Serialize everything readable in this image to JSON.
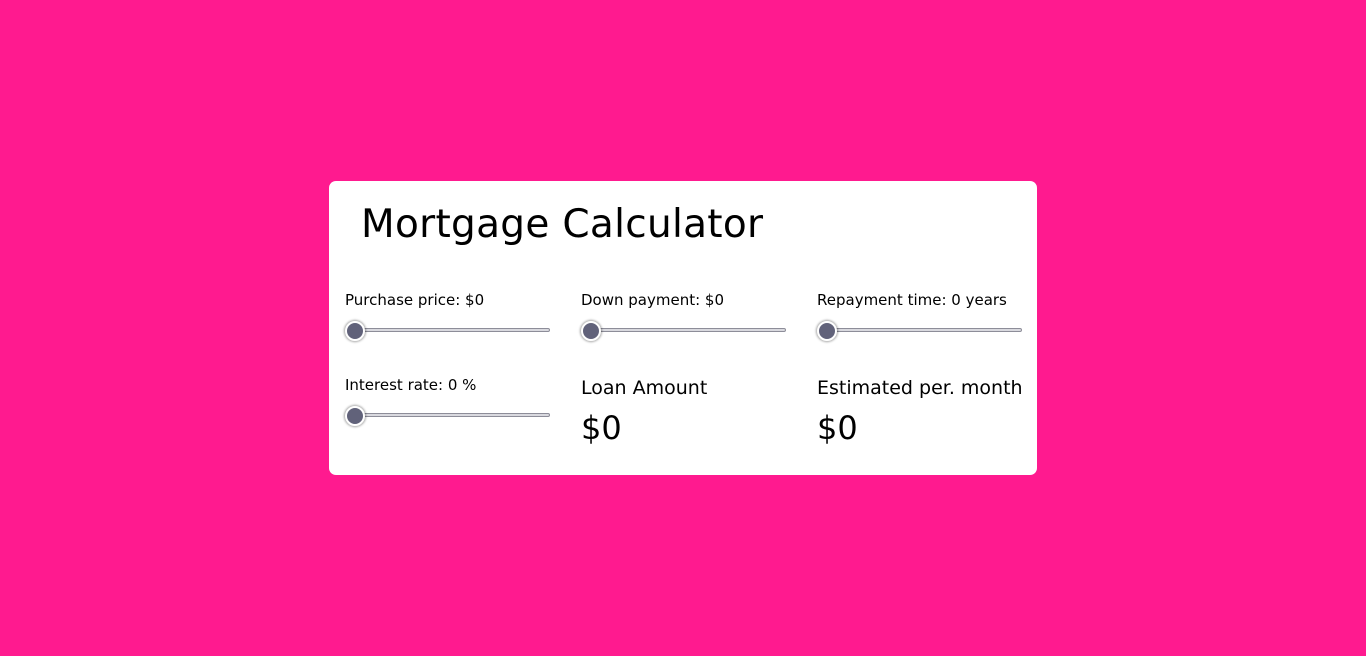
{
  "calculator": {
    "title": "Mortgage Calculator",
    "sliders": [
      {
        "label": "Purchase price: $0",
        "value_fraction": 0
      },
      {
        "label": "Down payment: $0",
        "value_fraction": 0
      },
      {
        "label": "Repayment time: 0 years",
        "value_fraction": 0
      },
      {
        "label": "Interest rate: 0 %",
        "value_fraction": 0
      }
    ],
    "loan_amount": {
      "label": "Loan Amount",
      "value": "$0"
    },
    "monthly": {
      "label": "Estimated per. month",
      "value": "$0"
    }
  },
  "colors": {
    "background": "#ff1a8f",
    "card": "#ffffff",
    "slider_thumb": "#61627a"
  }
}
